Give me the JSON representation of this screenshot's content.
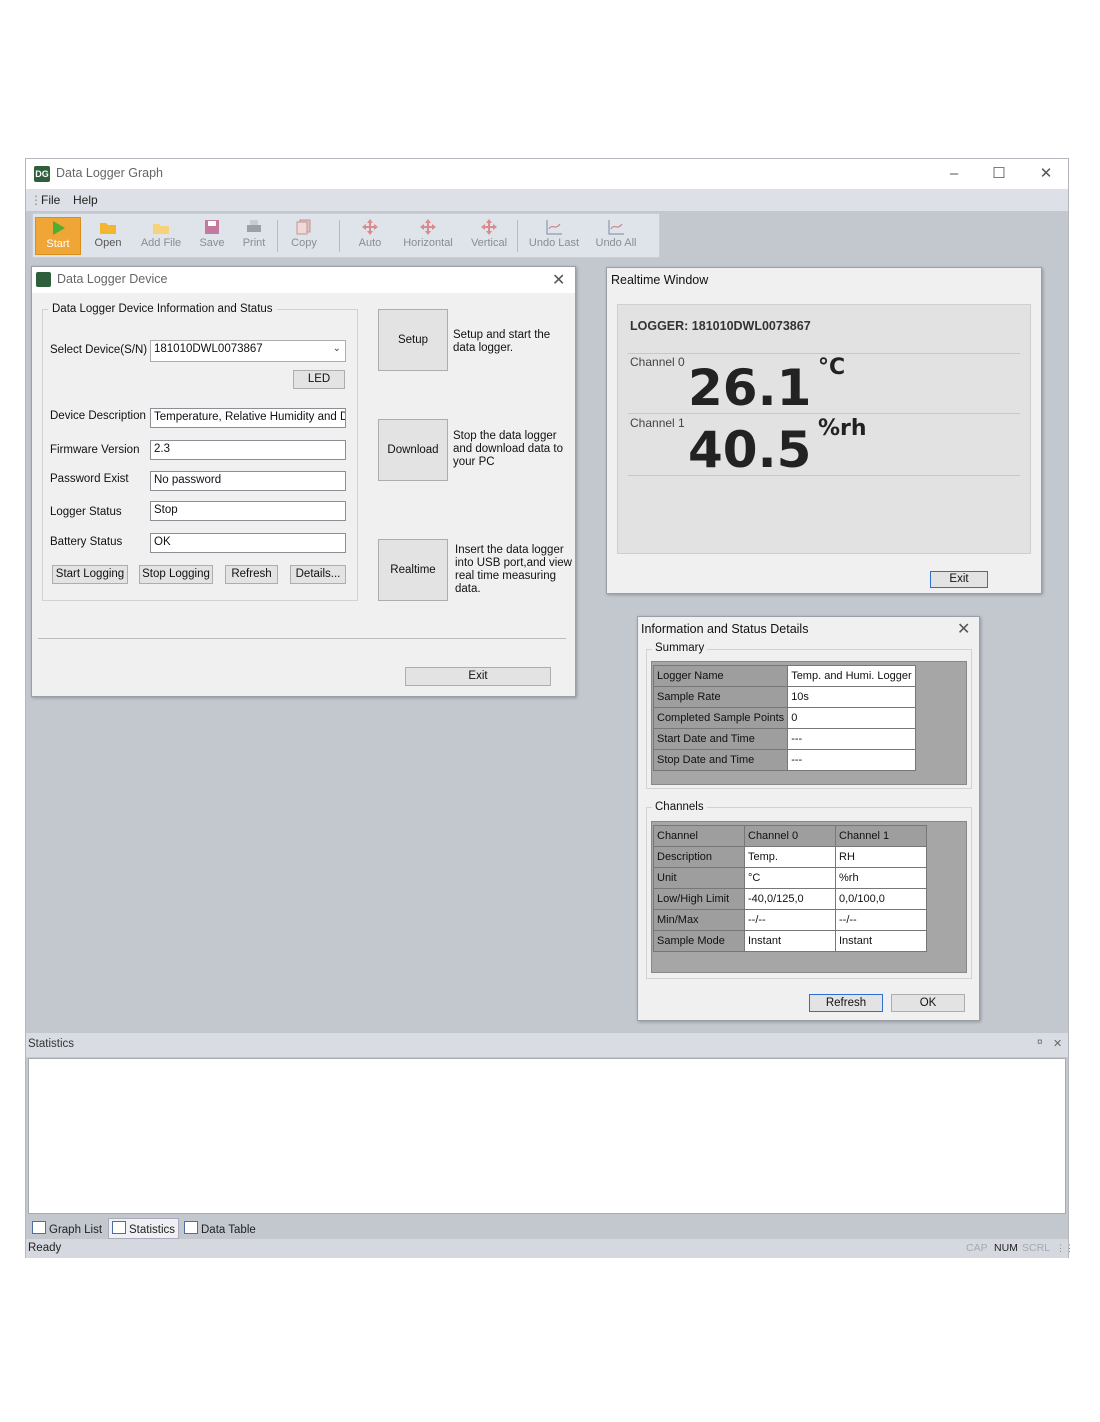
{
  "app": {
    "title": "Data Logger Graph",
    "icon_letters": "DG",
    "menu": [
      "File",
      "Help"
    ],
    "toolbar": {
      "items": [
        {
          "label": "Start",
          "icon": "play-icon"
        },
        {
          "label": "Open",
          "icon": "folder-open-icon"
        },
        {
          "label": "Add File",
          "icon": "add-file-icon"
        },
        {
          "label": "Save",
          "icon": "save-icon"
        },
        {
          "label": "Print",
          "icon": "print-icon"
        },
        {
          "label": "Copy",
          "icon": "copy-icon"
        },
        {
          "label": "Auto",
          "icon": "move-icon"
        },
        {
          "label": "Horizontal",
          "icon": "horizontal-move-icon"
        },
        {
          "label": "Vertical",
          "icon": "vertical-move-icon"
        },
        {
          "label": "Undo Last",
          "icon": "undo-zoom-icon"
        },
        {
          "label": "Undo All",
          "icon": "undo-all-icon"
        }
      ],
      "accent": "#f0a637"
    }
  },
  "device_window": {
    "title": "Data Logger Device",
    "group_title": "Data Logger Device Information and Status",
    "select_label": "Select Device(S/N)",
    "select_value": "181010DWL0073867",
    "led_button": "LED",
    "fields": [
      {
        "label": "Device Description",
        "value": "Temperature, Relative Humidity and De"
      },
      {
        "label": "Firmware Version",
        "value": "2.3"
      },
      {
        "label": "Password Exist",
        "value": "No password"
      },
      {
        "label": "Logger Status",
        "value": "Stop"
      },
      {
        "label": "Battery Status",
        "value": "OK"
      }
    ],
    "buttons": {
      "start_logging": "Start Logging",
      "stop_logging": "Stop Logging",
      "refresh": "Refresh",
      "details": "Details..."
    },
    "actions": [
      {
        "button": "Setup",
        "text": "Setup and start the data logger."
      },
      {
        "button": "Download",
        "text": "Stop the data logger and download data to your PC"
      },
      {
        "button": "Realtime",
        "text": "Insert the data logger into USB port,and view real time measuring data."
      }
    ],
    "exit": "Exit"
  },
  "realtime_window": {
    "title": "Realtime Window",
    "logger": "LOGGER: 181010DWL0073867",
    "channels": [
      {
        "label": "Channel 0",
        "value": "26.1",
        "unit": "°C"
      },
      {
        "label": "Channel 1",
        "value": "40.5",
        "unit": "%rh"
      }
    ],
    "exit": "Exit"
  },
  "details_window": {
    "title": "Information and Status Details",
    "summary_title": "Summary",
    "summary_rows": [
      [
        "Logger Name",
        "Temp. and Humi. Logger"
      ],
      [
        "Sample Rate",
        "10s"
      ],
      [
        "Completed Sample Points",
        "0"
      ],
      [
        "Start Date and Time",
        "---"
      ],
      [
        "Stop Date and Time",
        "---"
      ]
    ],
    "channels_title": "Channels",
    "channel_header": [
      "Channel",
      "Channel 0",
      "Channel 1"
    ],
    "channel_rows": [
      [
        "Description",
        "Temp.",
        "RH"
      ],
      [
        "Unit",
        "°C",
        "%rh"
      ],
      [
        "Low/High Limit",
        "-40,0/125,0",
        "0,0/100,0"
      ],
      [
        "Min/Max",
        "--/--",
        "--/--"
      ],
      [
        "Sample Mode",
        "Instant",
        "Instant"
      ]
    ],
    "refresh": "Refresh",
    "ok": "OK"
  },
  "statistics_panel": {
    "title": "Statistics",
    "pin": "¤",
    "close": "✕"
  },
  "bottom_tabs": [
    "Graph List",
    "Statistics",
    "Data Table"
  ],
  "status_bar": {
    "text": "Ready",
    "indicators": [
      "CAP",
      "NUM",
      "SCRL"
    ]
  }
}
